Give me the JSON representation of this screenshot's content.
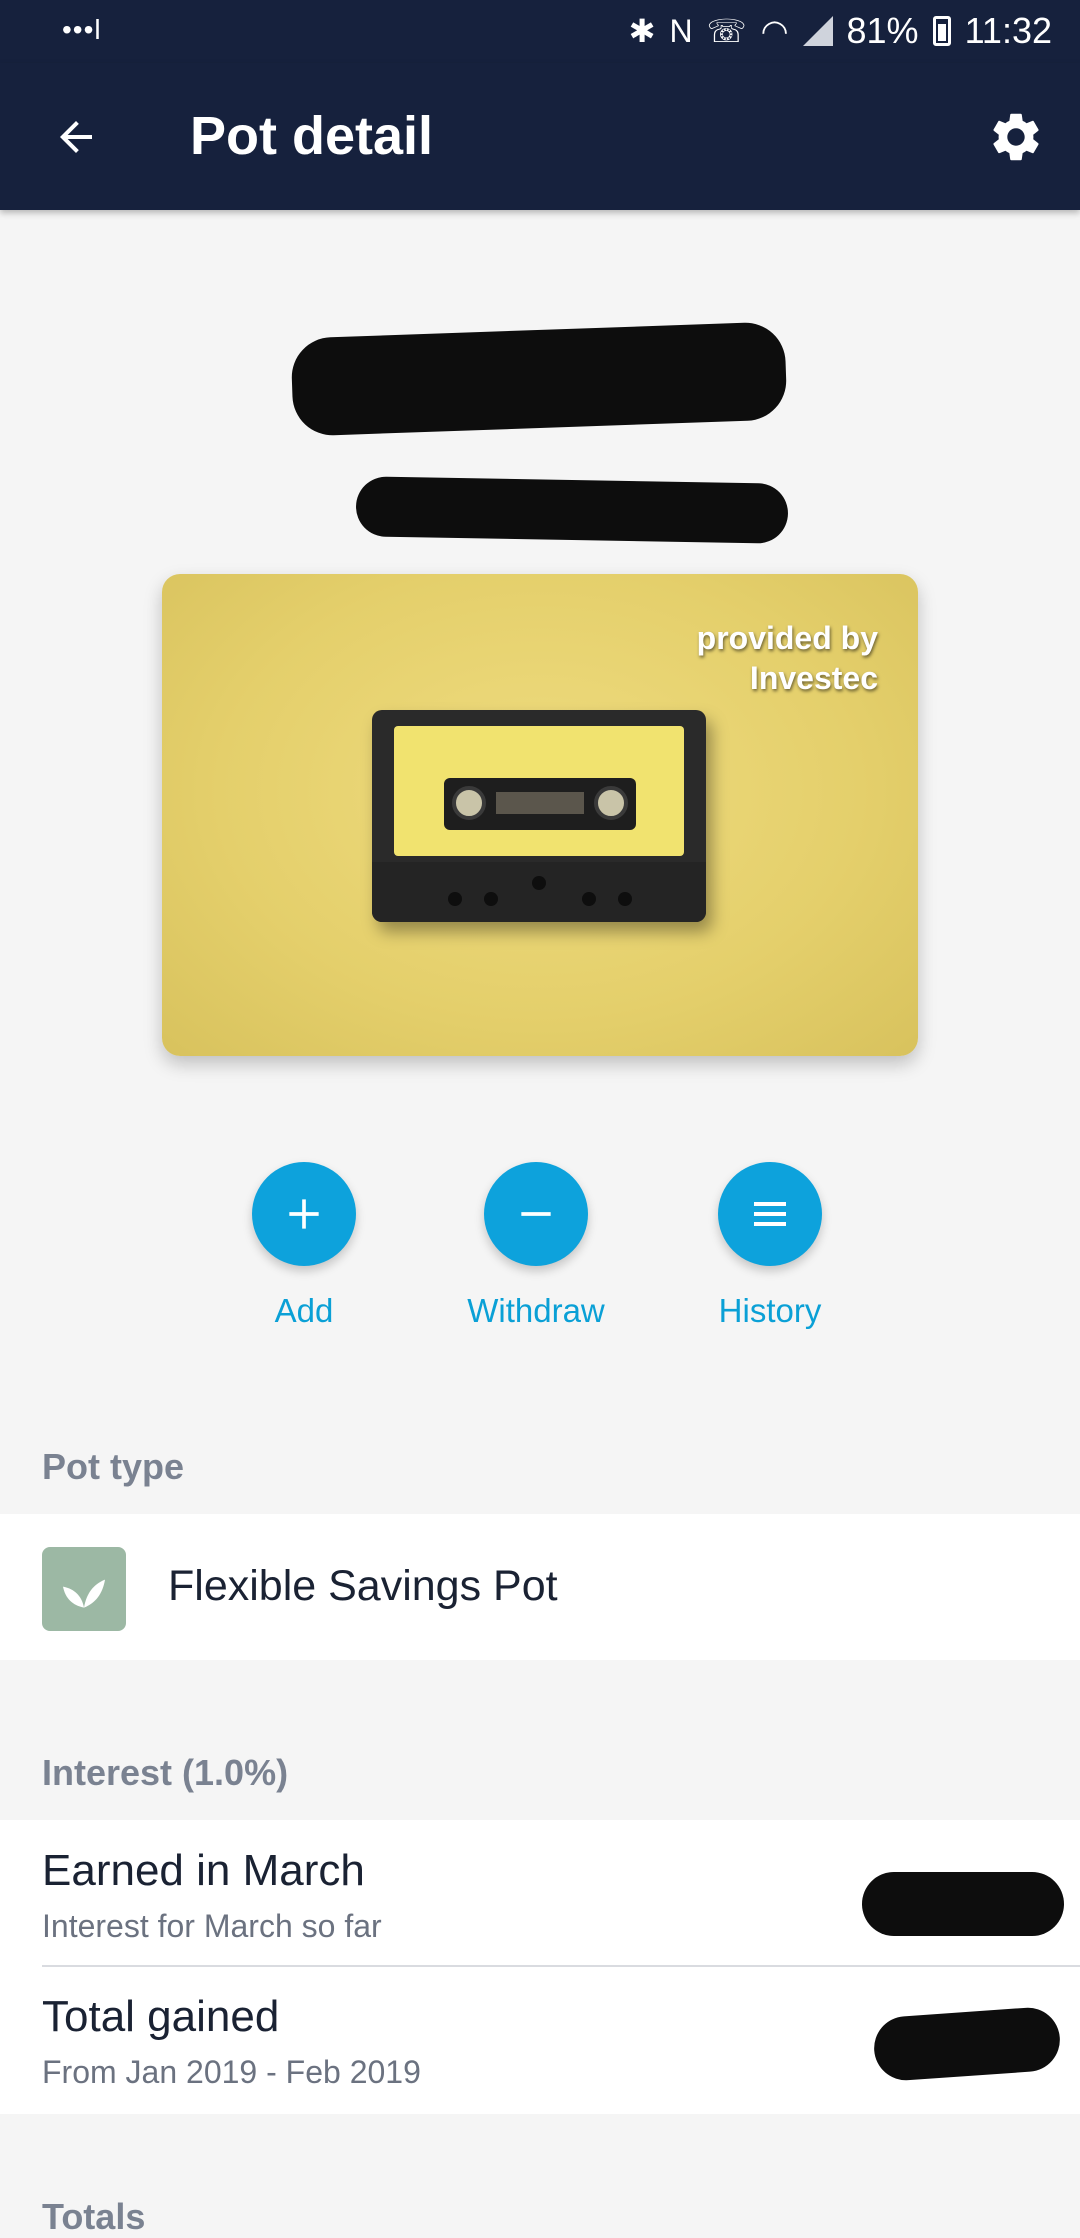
{
  "status_bar": {
    "left_indicator": "•••l",
    "icons": [
      "bluetooth-icon",
      "nfc-icon",
      "wifi-calling-icon",
      "wifi-icon",
      "signal-icon",
      "battery-icon"
    ],
    "battery": "81%",
    "time": "11:32"
  },
  "header": {
    "title": "Pot detail",
    "back_icon": "arrow-left-icon",
    "settings_icon": "gear-icon"
  },
  "pot_image": {
    "provided_by_line1": "provided by",
    "provided_by_line2": "Investec"
  },
  "actions": [
    {
      "label": "Add",
      "icon": "plus-icon"
    },
    {
      "label": "Withdraw",
      "icon": "minus-icon"
    },
    {
      "label": "History",
      "icon": "menu-lines-icon"
    }
  ],
  "pot_type": {
    "header": "Pot type",
    "name": "Flexible Savings Pot",
    "icon": "leaf-icon"
  },
  "interest": {
    "header": "Interest (1.0%)",
    "rows": [
      {
        "title": "Earned in March",
        "subtitle": "Interest for March so far"
      },
      {
        "title": "Total gained",
        "subtitle": "From Jan 2019 - Feb 2019"
      }
    ]
  },
  "totals": {
    "header": "Totals"
  },
  "colors": {
    "header_bg": "#16213d",
    "accent": "#0da2dc",
    "background": "#f5f5f5",
    "pot_icon_bg": "#9cb8a4"
  }
}
